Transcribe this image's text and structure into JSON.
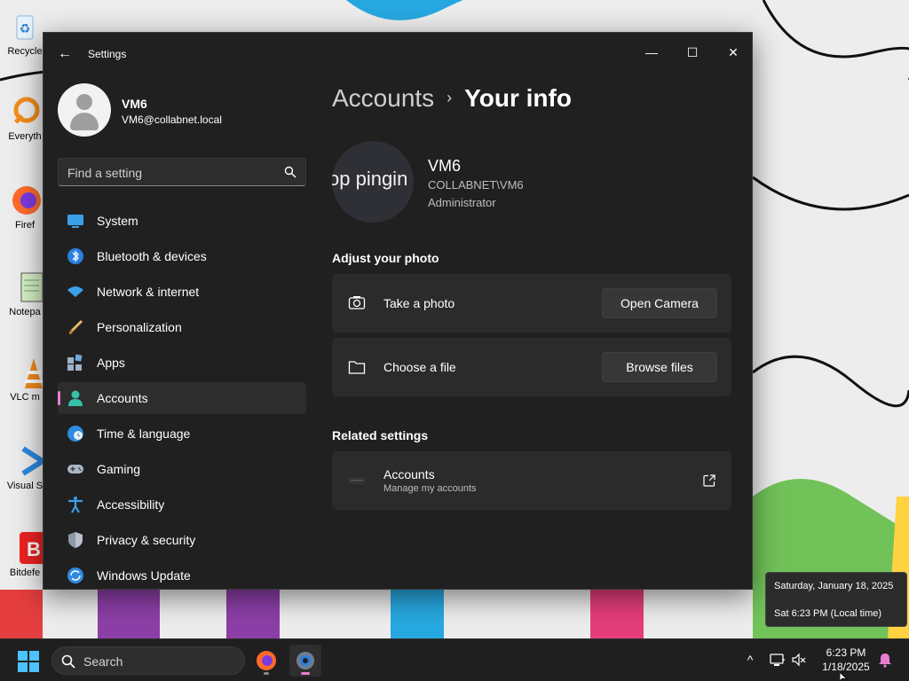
{
  "window": {
    "title": "Settings",
    "back_glyph": "←",
    "minimize_glyph": "—",
    "maximize_glyph": "☐",
    "close_glyph": "✕"
  },
  "profile": {
    "name": "VM6",
    "email": "VM6@collabnet.local"
  },
  "search": {
    "placeholder": "Find a setting"
  },
  "sidebar": {
    "items": [
      {
        "label": "System",
        "icon": "system-icon"
      },
      {
        "label": "Bluetooth & devices",
        "icon": "bluetooth-icon"
      },
      {
        "label": "Network & internet",
        "icon": "wifi-icon"
      },
      {
        "label": "Personalization",
        "icon": "brush-icon"
      },
      {
        "label": "Apps",
        "icon": "apps-icon"
      },
      {
        "label": "Accounts",
        "icon": "accounts-icon",
        "active": true
      },
      {
        "label": "Time & language",
        "icon": "globe-clock-icon"
      },
      {
        "label": "Gaming",
        "icon": "gamepad-icon"
      },
      {
        "label": "Accessibility",
        "icon": "accessibility-icon"
      },
      {
        "label": "Privacy & security",
        "icon": "shield-icon"
      },
      {
        "label": "Windows Update",
        "icon": "update-icon"
      }
    ]
  },
  "breadcrumb": {
    "parent": "Accounts",
    "separator": "›",
    "current": "Your info"
  },
  "user": {
    "picture_text": "op pingin",
    "name": "VM6",
    "domain_account": "COLLABNET\\VM6",
    "role": "Administrator"
  },
  "photo_section": {
    "title": "Adjust your photo",
    "take_photo_label": "Take a photo",
    "open_camera_label": "Open Camera",
    "choose_file_label": "Choose a file",
    "browse_files_label": "Browse files"
  },
  "related": {
    "title": "Related settings",
    "accounts_title": "Accounts",
    "accounts_subtitle": "Manage my accounts"
  },
  "clock_tooltip": {
    "line1": "Saturday, January 18, 2025",
    "line2": "Sat 6:23 PM (Local time)"
  },
  "taskbar": {
    "search_label": "Search",
    "time": "6:23 PM",
    "date": "1/18/2025",
    "chevron_glyph": "^",
    "accent": "#4cc2ff"
  },
  "desktop_icons": [
    {
      "label": "Recycle",
      "icon": "recycle-bin-icon"
    },
    {
      "label": "Everyth",
      "icon": "everything-icon"
    },
    {
      "label": "Firef",
      "icon": "firefox-icon"
    },
    {
      "label": "Notepa",
      "icon": "notepad-icon"
    },
    {
      "label": "VLC m",
      "icon": "vlc-icon"
    },
    {
      "label": "Visual S",
      "icon": "vscode-icon"
    },
    {
      "label": "Bitdefe",
      "icon": "bitdefender-icon"
    }
  ]
}
